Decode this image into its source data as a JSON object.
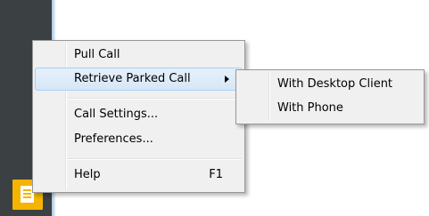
{
  "context_menu": {
    "items": [
      {
        "label": "Pull Call"
      },
      {
        "label": "Retrieve Parked Call"
      },
      {
        "label": "Call Settings..."
      },
      {
        "label": "Preferences..."
      },
      {
        "label": "Help",
        "shortcut": "F1"
      }
    ]
  },
  "submenu": {
    "items": [
      {
        "label": "With Desktop Client"
      },
      {
        "label": "With Phone"
      }
    ]
  },
  "colors": {
    "menu_bg": "#f0f0f0",
    "highlight": "#d6e7f8",
    "taskbar": "#3b4043",
    "app_icon": "#f5b400"
  },
  "icons": {
    "app_icon": "notes-document-icon",
    "submenu_arrow": "chevron-right-icon"
  }
}
